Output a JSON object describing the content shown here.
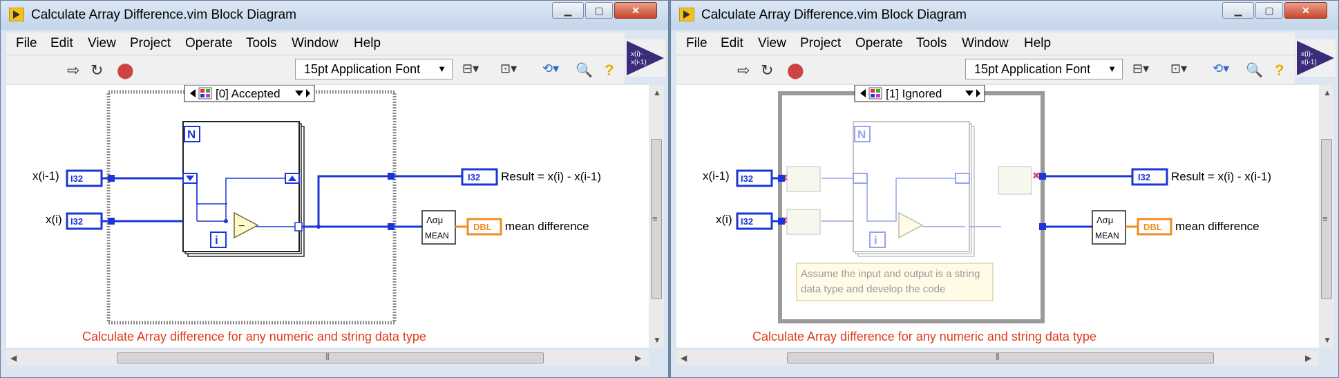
{
  "colors": {
    "wire_blue": "#1b36d6",
    "comment_red": "#e03a18",
    "dbl_orange": "#f28a1e",
    "structure_gray": "#9a9a9a",
    "note_bg": "#fffbe6"
  },
  "windows": [
    {
      "title": "Calculate Array Difference.vim Block Diagram",
      "menu": [
        "File",
        "Edit",
        "View",
        "Project",
        "Operate",
        "Tools",
        "Window",
        "Help"
      ],
      "font_select": "15pt Application Font",
      "case_selector": "[0] Accepted",
      "terminals": {
        "in1": "x(i-1)",
        "in2": "x(i)",
        "in_type": "I32",
        "out1_label": "Result = x(i) - x(i-1)",
        "out1_type": "I32",
        "out2_label": "mean difference",
        "out2_type": "DBL",
        "mean_label": "MEAN",
        "mean_symbol": "Λσμ",
        "loop_n": "N",
        "loop_i": "i"
      },
      "comment": "Calculate Array difference for any numeric and string data type"
    },
    {
      "title": "Calculate Array Difference.vim Block Diagram",
      "menu": [
        "File",
        "Edit",
        "View",
        "Project",
        "Operate",
        "Tools",
        "Window",
        "Help"
      ],
      "font_select": "15pt Application Font",
      "case_selector": "[1] Ignored",
      "terminals": {
        "in1": "x(i-1)",
        "in2": "x(i)",
        "in_type": "I32",
        "out1_label": "Result = x(i) - x(i-1)",
        "out1_type": "I32",
        "out2_label": "mean difference",
        "out2_type": "DBL",
        "mean_label": "MEAN",
        "mean_symbol": "Λσμ",
        "loop_n": "N",
        "loop_i": "i"
      },
      "note": [
        "Assume the input and output is a string",
        "data type and develop the code"
      ],
      "comment": "Calculate Array difference for any numeric and string data type"
    }
  ]
}
